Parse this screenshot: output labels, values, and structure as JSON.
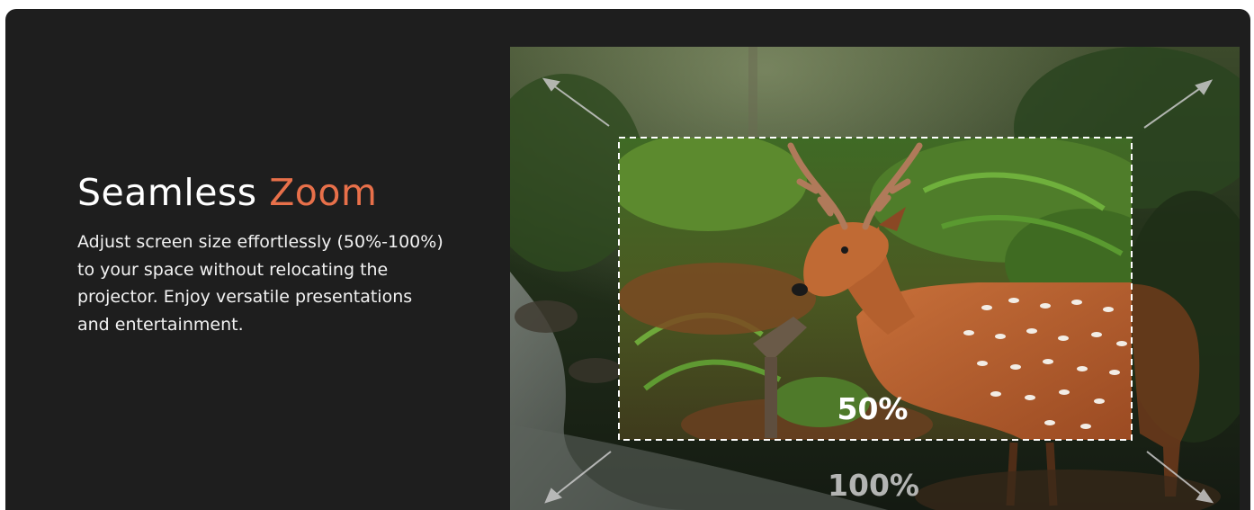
{
  "headline": {
    "prefix": "Seamless",
    "accent": "Zoom",
    "accent_color": "#e8704a"
  },
  "description_lines": [
    "Adjust screen size effortlessly (50%-100%)",
    "to your space without relocating the",
    "projector. Enjoy versatile presentations",
    "and entertainment."
  ],
  "zoom": {
    "inner_label": "50%",
    "outer_label": "100%",
    "inner_scale": 0.5,
    "outer_scale": 1.0
  },
  "icons": {
    "arrows": [
      "arrow-top-left-icon",
      "arrow-top-right-icon",
      "arrow-bottom-left-icon",
      "arrow-bottom-right-icon"
    ]
  }
}
